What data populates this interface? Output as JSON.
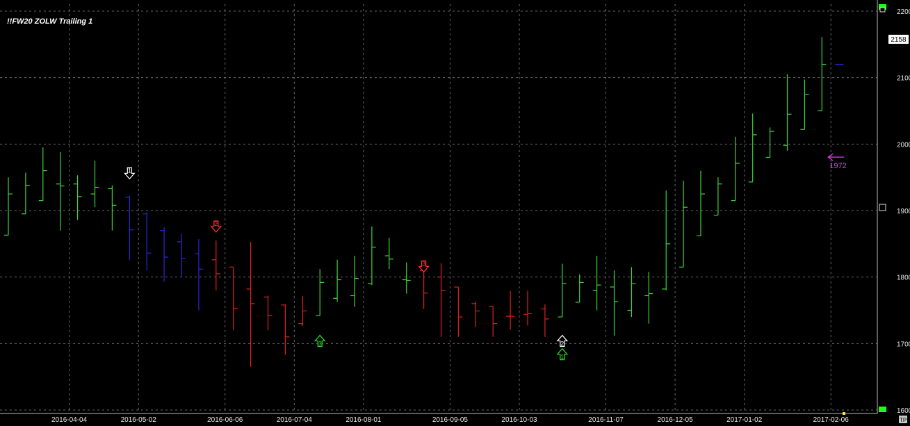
{
  "chart_data": {
    "type": "ohlc",
    "title": "!!FW20 ZOLW Trailing 1",
    "ylim": [
      1600,
      2200
    ],
    "y_ticks": [
      "2200",
      "2100",
      "2000",
      "1900",
      "1800",
      "1700",
      "1600"
    ],
    "x_ticks": [
      "2016-04-04",
      "2016-05-02",
      "2016-06-06",
      "2016-07-04",
      "2016-08-01",
      "2016-09-05",
      "2016-10-03",
      "2016-11-07",
      "2016-12-05",
      "2017-01-02",
      "2017-02-06"
    ],
    "x_tick_index": [
      4,
      8,
      13,
      17,
      21,
      26,
      30,
      35,
      39,
      43,
      48
    ],
    "grid": true,
    "last_price": "2158",
    "colors": {
      "up": "#3fd43f",
      "down": "#e02020",
      "neutral": "#2a2ad8",
      "annotation": "#e040e0",
      "marker_up": "#26e026",
      "marker_down": "#ff3030",
      "marker_white": "#ffffff"
    },
    "bars": [
      {
        "o": 1863,
        "h": 1950,
        "l": 1863,
        "c": 1925,
        "t": "up"
      },
      {
        "o": 1895,
        "h": 1957,
        "l": 1895,
        "c": 1938,
        "t": "up"
      },
      {
        "o": 1915,
        "h": 1995,
        "l": 1915,
        "c": 1960,
        "t": "up"
      },
      {
        "o": 1940,
        "h": 1988,
        "l": 1870,
        "c": 1937,
        "t": "up"
      },
      {
        "o": 1940,
        "h": 1953,
        "l": 1886,
        "c": 1921,
        "t": "up"
      },
      {
        "o": 1925,
        "h": 1975,
        "l": 1905,
        "c": 1935,
        "t": "up"
      },
      {
        "o": 1933,
        "h": 1938,
        "l": 1870,
        "c": 1908,
        "t": "up"
      },
      {
        "o": 1920,
        "h": 1922,
        "l": 1826,
        "c": 1871,
        "t": "neutral"
      },
      {
        "o": 1895,
        "h": 1897,
        "l": 1810,
        "c": 1836,
        "t": "neutral"
      },
      {
        "o": 1870,
        "h": 1875,
        "l": 1793,
        "c": 1830,
        "t": "neutral"
      },
      {
        "o": 1853,
        "h": 1865,
        "l": 1800,
        "c": 1828,
        "t": "neutral"
      },
      {
        "o": 1835,
        "h": 1857,
        "l": 1750,
        "c": 1812,
        "t": "neutral"
      },
      {
        "o": 1826,
        "h": 1855,
        "l": 1780,
        "c": 1805,
        "t": "down"
      },
      {
        "o": 1815,
        "h": 1815,
        "l": 1720,
        "c": 1753,
        "t": "down"
      },
      {
        "o": 1782,
        "h": 1853,
        "l": 1665,
        "c": 1760,
        "t": "down"
      },
      {
        "o": 1770,
        "h": 1772,
        "l": 1720,
        "c": 1742,
        "t": "down"
      },
      {
        "o": 1758,
        "h": 1759,
        "l": 1683,
        "c": 1710,
        "t": "down"
      },
      {
        "o": 1730,
        "h": 1771,
        "l": 1726,
        "c": 1749,
        "t": "down"
      },
      {
        "o": 1742,
        "h": 1812,
        "l": 1742,
        "c": 1792,
        "t": "up"
      },
      {
        "o": 1768,
        "h": 1826,
        "l": 1763,
        "c": 1796,
        "t": "up"
      },
      {
        "o": 1772,
        "h": 1832,
        "l": 1755,
        "c": 1798,
        "t": "up"
      },
      {
        "o": 1790,
        "h": 1876,
        "l": 1788,
        "c": 1845,
        "t": "up"
      },
      {
        "o": 1832,
        "h": 1859,
        "l": 1812,
        "c": 1827,
        "t": "up"
      },
      {
        "o": 1796,
        "h": 1822,
        "l": 1775,
        "c": 1795,
        "t": "up"
      },
      {
        "o": 1810,
        "h": 1812,
        "l": 1752,
        "c": 1776,
        "t": "down"
      },
      {
        "o": 1800,
        "h": 1821,
        "l": 1710,
        "c": 1780,
        "t": "down"
      },
      {
        "o": 1785,
        "h": 1785,
        "l": 1710,
        "c": 1740,
        "t": "down"
      },
      {
        "o": 1760,
        "h": 1763,
        "l": 1725,
        "c": 1749,
        "t": "down"
      },
      {
        "o": 1756,
        "h": 1757,
        "l": 1710,
        "c": 1730,
        "t": "down"
      },
      {
        "o": 1741,
        "h": 1779,
        "l": 1721,
        "c": 1741,
        "t": "down"
      },
      {
        "o": 1744,
        "h": 1780,
        "l": 1727,
        "c": 1745,
        "t": "down"
      },
      {
        "o": 1752,
        "h": 1759,
        "l": 1710,
        "c": 1737,
        "t": "down"
      },
      {
        "o": 1740,
        "h": 1820,
        "l": 1740,
        "c": 1790,
        "t": "up"
      },
      {
        "o": 1762,
        "h": 1804,
        "l": 1762,
        "c": 1792,
        "t": "up"
      },
      {
        "o": 1780,
        "h": 1832,
        "l": 1750,
        "c": 1788,
        "t": "up"
      },
      {
        "o": 1785,
        "h": 1810,
        "l": 1712,
        "c": 1763,
        "t": "up"
      },
      {
        "o": 1750,
        "h": 1815,
        "l": 1740,
        "c": 1790,
        "t": "up"
      },
      {
        "o": 1772,
        "h": 1808,
        "l": 1730,
        "c": 1775,
        "t": "up"
      },
      {
        "o": 1782,
        "h": 1930,
        "l": 1780,
        "c": 1850,
        "t": "up"
      },
      {
        "o": 1815,
        "h": 1945,
        "l": 1815,
        "c": 1905,
        "t": "up"
      },
      {
        "o": 1862,
        "h": 1960,
        "l": 1862,
        "c": 1925,
        "t": "up"
      },
      {
        "o": 1893,
        "h": 1950,
        "l": 1893,
        "c": 1940,
        "t": "up"
      },
      {
        "o": 1915,
        "h": 2011,
        "l": 1915,
        "c": 1971,
        "t": "up"
      },
      {
        "o": 1943,
        "h": 2046,
        "l": 1943,
        "c": 2014,
        "t": "up"
      },
      {
        "o": 1980,
        "h": 2025,
        "l": 1980,
        "c": 2019,
        "t": "up"
      },
      {
        "o": 1998,
        "h": 2105,
        "l": 1990,
        "c": 2045,
        "t": "up"
      },
      {
        "o": 2022,
        "h": 2097,
        "l": 2022,
        "c": 2075,
        "t": "up"
      },
      {
        "o": 2050,
        "h": 2161,
        "l": 2050,
        "c": 2120,
        "t": "up"
      },
      {
        "o": 2120,
        "h": 2120,
        "l": 2120,
        "c": 2120,
        "t": "neutral"
      }
    ],
    "signals": [
      {
        "bar": 7,
        "dir": "down",
        "label": "1",
        "price": 1955,
        "color": "white"
      },
      {
        "bar": 12,
        "dir": "down",
        "label": "2",
        "price": 1875,
        "color": "red"
      },
      {
        "bar": 24,
        "dir": "down",
        "label": "3",
        "price": 1815,
        "color": "red"
      },
      {
        "bar": 18,
        "dir": "up",
        "label": "3",
        "price": 1705,
        "color": "green"
      },
      {
        "bar": 32,
        "dir": "up",
        "label": "2",
        "price": 1705,
        "color": "white"
      },
      {
        "bar": 32,
        "dir": "up",
        "label": "1",
        "price": 1685,
        "color": "green"
      }
    ],
    "annotation": {
      "text": "1972",
      "price": 1972,
      "bar": 47.4
    }
  }
}
